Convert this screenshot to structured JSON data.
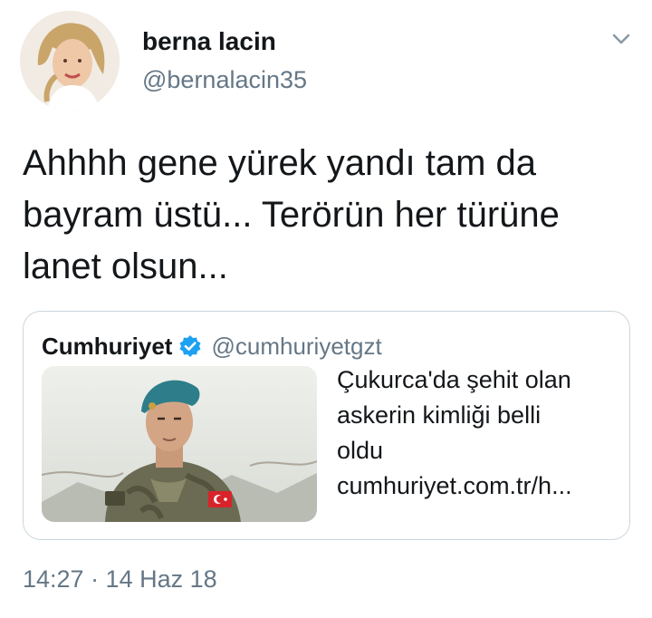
{
  "author": {
    "display_name": "berna lacin",
    "handle": "@bernalacin35"
  },
  "tweet": {
    "lines": [
      "Ahhhh gene yürek yandı tam da",
      "bayram üstü... Terörün her türüne",
      "lanet olsun..."
    ],
    "timestamp": "14:27 · 14 Haz 18"
  },
  "quoted": {
    "name": "Cumhuriyet",
    "handle": "@cumhuriyetgzt",
    "verified_color": "#1da1f2",
    "lines": [
      "Çukurca'da şehit olan",
      "askerin kimliği belli",
      "oldu",
      "cumhuriyet.com.tr/h..."
    ]
  },
  "icons": {
    "menu": "chevron-down-icon",
    "verified": "verified-badge-icon"
  }
}
